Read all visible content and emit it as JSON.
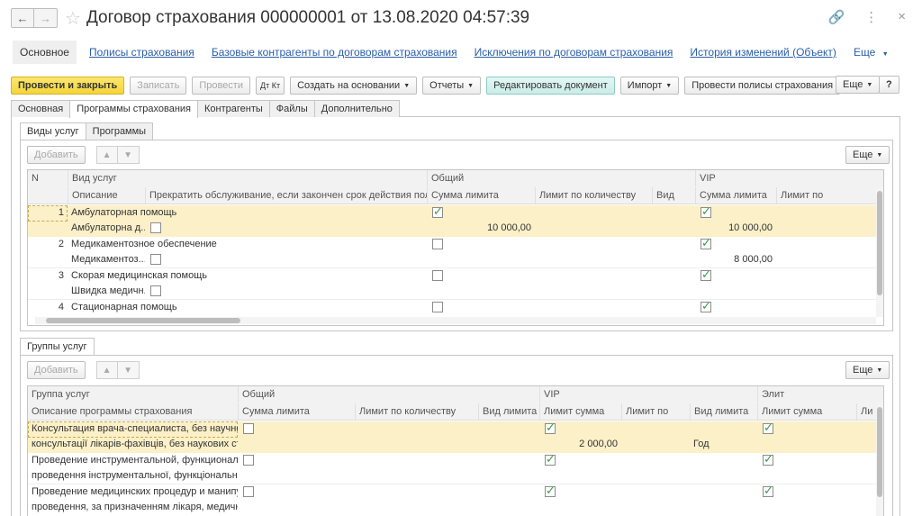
{
  "window": {
    "title": "Договор страхования 000000001 от 13.08.2020 04:57:39",
    "back_icon": "arrow-left-icon",
    "forward_icon": "arrow-right-icon",
    "link_glyph": "🔗",
    "menu_glyph": "⋮",
    "close_glyph": "×"
  },
  "nav": {
    "items": [
      "Основное",
      "Полисы страхования",
      "Базовые контрагенты по договорам страхования",
      "Исключения по договорам страхования",
      "История изменений (Объект)"
    ],
    "more": "Еще"
  },
  "toolbar": {
    "post_close": "Провести и закрыть",
    "save": "Записать",
    "post": "Провести",
    "dtkt": "Дт Кт",
    "create_based": "Создать на основании",
    "reports": "Отчеты",
    "edit_doc": "Редактировать документ",
    "import": "Импорт",
    "post_policies": "Провести полисы страхования",
    "more": "Еще",
    "help": "?"
  },
  "tabs": [
    "Основная",
    "Программы страхования",
    "Контрагенты",
    "Файлы",
    "Дополнительно"
  ],
  "services_section": {
    "subtabs": [
      "Виды услуг",
      "Программы"
    ],
    "add": "Добавить",
    "more": "Еще",
    "columns_top": [
      "N",
      "Вид услуг",
      "Общий",
      "VIP"
    ],
    "columns_bottom": [
      "Описание",
      "Прекратить обслуживание, если закончен срок действия полиса",
      "Сумма лимита",
      "Лимит по количеству",
      "Вид",
      "Сумма лимита",
      "Лимит по"
    ],
    "rows": [
      {
        "n": "1",
        "name": "Амбулаторная помощь",
        "desc": "Амбулаторна д...",
        "stop": false,
        "general": true,
        "general_sum": "10 000,00",
        "vip": true,
        "vip_sum": "10 000,00"
      },
      {
        "n": "2",
        "name": "Медикаментозное обеспечение",
        "desc": "Медикаментоз...",
        "stop": false,
        "general": false,
        "general_sum": "",
        "vip": true,
        "vip_sum": "8 000,00"
      },
      {
        "n": "3",
        "name": "Скорая медицинская помощь",
        "desc": "Швидка медичн...",
        "stop": false,
        "general": false,
        "general_sum": "",
        "vip": true,
        "vip_sum": ""
      },
      {
        "n": "4",
        "name": "Стационарная помощь",
        "desc": "",
        "stop": false,
        "general": false,
        "general_sum": "",
        "vip": true,
        "vip_sum": ""
      }
    ]
  },
  "groups_section": {
    "subtab": "Группы услуг",
    "add": "Добавить",
    "more": "Еще",
    "columns_top": [
      "Группа услуг",
      "Общий",
      "VIP",
      "Элит"
    ],
    "columns_bottom": [
      "Описание программы страхования",
      "Сумма лимита",
      "Лимит по количеству",
      "Вид лимита",
      "Лимит сумма",
      "Лимит по",
      "Вид лимита",
      "Лимит сумма",
      "Ли"
    ],
    "rows": [
      {
        "name": "Консультация врача-специалиста, без научной...",
        "desc": "консультації лікарів-фахівців, без наукових сту...",
        "general": false,
        "vip": true,
        "vip_sum": "2 000,00",
        "vip_kind": "Год",
        "elite": true
      },
      {
        "name": "Проведение инструментальной, функциональн...",
        "desc": "проведення інструментальної, функціональної ...",
        "general": false,
        "vip": true,
        "vip_sum": "",
        "vip_kind": "",
        "elite": true
      },
      {
        "name": "Проведение медицинских процедур и манипул...",
        "desc": "проведення, за призначенням лікаря, медични...",
        "general": false,
        "vip": true,
        "vip_sum": "",
        "vip_kind": "",
        "elite": true
      }
    ]
  }
}
